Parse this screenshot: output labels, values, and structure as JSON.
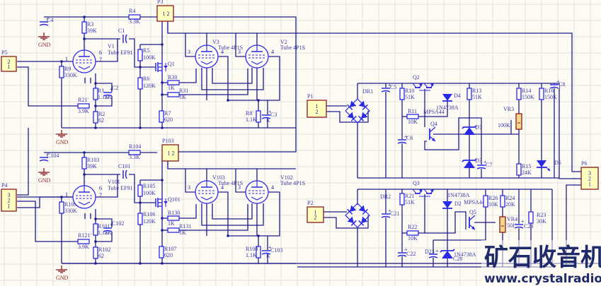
{
  "colors": {
    "wire": "#1c1c8c",
    "component": "#2a2ae6",
    "label": "#3a3aa8",
    "connector_fill": "#ffffc0",
    "connector_border": "#8b1a1a",
    "ground": "#8b1a1a",
    "background": "#fdfbf4"
  },
  "net_labels": {
    "gnd": "GND"
  },
  "connectors": {
    "P3": {
      "ref": "P3",
      "pins": [
        "1",
        "2"
      ]
    },
    "P103": {
      "ref": "P103",
      "pins": [
        "1",
        "2"
      ]
    },
    "P5": {
      "ref": "P5",
      "pins": [
        "2",
        "1"
      ]
    },
    "P4": {
      "ref": "P4",
      "pins": [
        "3",
        "2",
        "1"
      ]
    },
    "P1": {
      "ref": "P1",
      "pins": [
        "1",
        "2"
      ]
    },
    "P2": {
      "ref": "P2",
      "pins": [
        "1",
        "2"
      ]
    },
    "P6": {
      "ref": "P6",
      "pins": [
        "3",
        "2",
        "1"
      ]
    }
  },
  "tube_pins": {
    "input": [
      "1",
      "6",
      "7"
    ],
    "output": [
      "3",
      "4"
    ]
  },
  "components": {
    "R4": {
      "ref": "R4",
      "value": "3.3K"
    },
    "R3": {
      "ref": "R3",
      "value": "39K"
    },
    "C4": {
      "ref": "C4",
      "value": ""
    },
    "C1": {
      "ref": "C1",
      "value": ""
    },
    "R9": {
      "ref": "R9",
      "value": "330K"
    },
    "R21p": {
      "ref": "R21'",
      "value": "3.9K"
    },
    "R1": {
      "ref": "R1",
      "value": "1.1K"
    },
    "C2": {
      "ref": "C2",
      "value": "2K"
    },
    "R2": {
      "ref": "R2",
      "value": "62"
    },
    "R5": {
      "ref": "R5",
      "value": "100K"
    },
    "R6": {
      "ref": "R6",
      "value": "120K"
    },
    "R7": {
      "ref": "R7",
      "value": "620"
    },
    "R30": {
      "ref": "R30",
      "value": "1K"
    },
    "R31": {
      "ref": "R31",
      "value": "1K"
    },
    "R8p": {
      "ref": "R8'",
      "value": "1.1K"
    },
    "C3": {
      "ref": "C3",
      "value": "K"
    },
    "Q1": {
      "ref": "Q1",
      "value": ""
    },
    "V1": {
      "ref": "V1",
      "value": "Tube EF91"
    },
    "V3": {
      "ref": "V3",
      "value": "Tube 4P1S"
    },
    "V2": {
      "ref": "V2",
      "value": "Tube 4P1S"
    },
    "R104": {
      "ref": "R104",
      "value": "3.3K"
    },
    "R103": {
      "ref": "R103",
      "value": "39K"
    },
    "C104": {
      "ref": "C104",
      "value": ""
    },
    "C101": {
      "ref": "C101",
      "value": ""
    },
    "R109": {
      "ref": "R109",
      "value": "330K"
    },
    "R121p": {
      "ref": "R121'",
      "value": "3.9K"
    },
    "R101": {
      "ref": "R101",
      "value": "1.1K"
    },
    "C102": {
      "ref": "C102",
      "value": "2K"
    },
    "R102": {
      "ref": "R102",
      "value": "62"
    },
    "R105": {
      "ref": "R105",
      "value": "100K"
    },
    "R106": {
      "ref": "R106",
      "value": "120K"
    },
    "R107": {
      "ref": "R107",
      "value": "620"
    },
    "R130": {
      "ref": "R130",
      "value": "1K"
    },
    "R131": {
      "ref": "R131",
      "value": "1K"
    },
    "R108": {
      "ref": "R108",
      "value": "1.1K"
    },
    "C103": {
      "ref": "C103",
      "value": "K"
    },
    "Q101": {
      "ref": "Q101",
      "value": ""
    },
    "V101": {
      "ref": "V101",
      "value": "Tube EF91"
    },
    "V103": {
      "ref": "V103",
      "value": "Tube 4P1S"
    },
    "V102": {
      "ref": "V102",
      "value": "Tube 4P1S"
    },
    "DR1": {
      "ref": "DR1",
      "value": ""
    },
    "C5": {
      "ref": "C5",
      "value": ""
    },
    "R10": {
      "ref": "R10",
      "value": "51K"
    },
    "R11": {
      "ref": "R11",
      "value": "10K"
    },
    "C6": {
      "ref": "C6",
      "value": ""
    },
    "Q2": {
      "ref": "Q2",
      "value": "MPSA44"
    },
    "D4": {
      "ref": "D4",
      "value": "1N4738A"
    },
    "Q4": {
      "ref": "Q4",
      "value": ""
    },
    "D7": {
      "ref": "D7",
      "value": ""
    },
    "D3": {
      "ref": "D3",
      "value": ""
    },
    "C7": {
      "ref": "C7",
      "value": ""
    },
    "R13": {
      "ref": "R13",
      "value": "51K"
    },
    "R14": {
      "ref": "R14",
      "value": "150K"
    },
    "VR3": {
      "ref": "VR3",
      "value": "100K"
    },
    "R15": {
      "ref": "R15",
      "value": "24K"
    },
    "R16": {
      "ref": "R16",
      "value": "150K"
    },
    "C8": {
      "ref": "C8",
      "value": ""
    },
    "D5": {
      "ref": "D5",
      "value": ""
    },
    "DR2": {
      "ref": "DR2",
      "value": ""
    },
    "C21": {
      "ref": "C21",
      "value": ""
    },
    "R21": {
      "ref": "R21",
      "value": "51K"
    },
    "R22": {
      "ref": "R22",
      "value": "10K"
    },
    "C22": {
      "ref": "C22",
      "value": ""
    },
    "Q3": {
      "ref": "Q3",
      "value": "MPSA44"
    },
    "D2": {
      "ref": "D2",
      "value": "1N4738A"
    },
    "Q5": {
      "ref": "Q5",
      "value": ""
    },
    "D23": {
      "ref": "D23",
      "value": "1N4738A"
    },
    "C28": {
      "ref": "C28",
      "value": ""
    },
    "R26": {
      "ref": "R26",
      "value": "10K"
    },
    "R24": {
      "ref": "R24",
      "value": "20K"
    },
    "VR4": {
      "ref": "VR4",
      "value": "50K"
    },
    "C23": {
      "ref": "C23",
      "value": ""
    },
    "R23": {
      "ref": "R23",
      "value": "30K"
    }
  },
  "watermark": {
    "title": "矿石收音机",
    "url": "www.crystalradio.cn"
  }
}
